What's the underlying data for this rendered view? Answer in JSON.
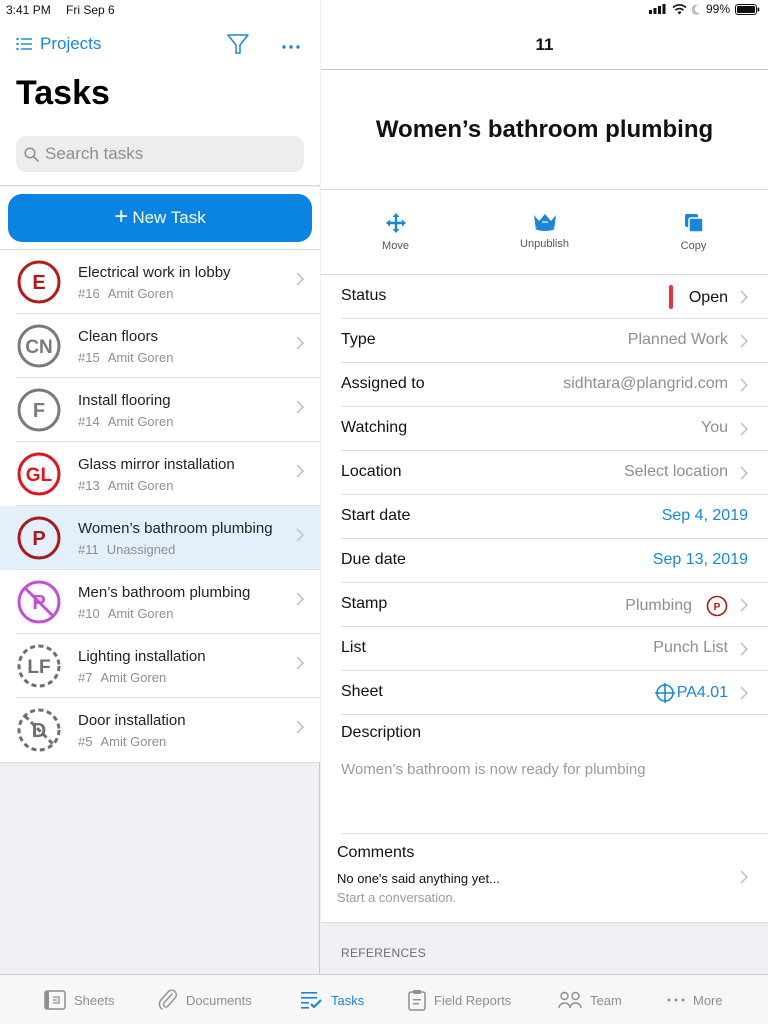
{
  "status_bar": {
    "time": "3:41 PM",
    "date": "Fri Sep 6",
    "battery": "99%"
  },
  "left": {
    "nav": {
      "projects_label": "Projects",
      "filter_icon": "filter-icon",
      "more_icon": "more-icon"
    },
    "title": "Tasks",
    "search": {
      "placeholder": "Search tasks",
      "value": ""
    },
    "new_task_label": "New Task",
    "tasks": [
      {
        "stamp": "E",
        "title": "Electrical work in lobby",
        "number": "#16",
        "assignee": "Amit Goren",
        "color": "#b31b1b",
        "style": "solid",
        "selected": false
      },
      {
        "stamp": "CN",
        "title": "Clean floors",
        "number": "#15",
        "assignee": "Amit Goren",
        "color": "#7a7a7a",
        "style": "solid",
        "selected": false
      },
      {
        "stamp": "F",
        "title": "Install flooring",
        "number": "#14",
        "assignee": "Amit Goren",
        "color": "#7a7a7a",
        "style": "solid",
        "selected": false
      },
      {
        "stamp": "GL",
        "title": "Glass mirror installation",
        "number": "#13",
        "assignee": "Amit Goren",
        "color": "#e0141c",
        "style": "solid",
        "selected": false
      },
      {
        "stamp": "P",
        "title": "Women’s bathroom plumbing",
        "number": "#11",
        "assignee": "Unassigned",
        "color": "#a51c1c",
        "style": "solid",
        "selected": true
      },
      {
        "stamp": "P",
        "title": "Men’s bathroom plumbing",
        "number": "#10",
        "assignee": "Amit Goren",
        "color": "#c24fd6",
        "style": "crossed",
        "selected": false
      },
      {
        "stamp": "LF",
        "title": "Lighting installation",
        "number": "#7",
        "assignee": "Amit Goren",
        "color": "#6e6e6e",
        "style": "dashed",
        "selected": false
      },
      {
        "stamp": "D",
        "title": "Door installation",
        "number": "#5",
        "assignee": "Amit Goren",
        "color": "#6e6e6e",
        "style": "dashed-crossed",
        "selected": false
      }
    ]
  },
  "detail": {
    "number": "11",
    "title": "Women’s bathroom plumbing",
    "actions": [
      {
        "label": "Move",
        "icon": "move-icon"
      },
      {
        "label": "Unpublish",
        "icon": "crown-icon"
      },
      {
        "label": "Copy",
        "icon": "copy-icon"
      }
    ],
    "fields": [
      {
        "label": "Status",
        "value": "Open",
        "status_color": "#e0373d"
      },
      {
        "label": "Type",
        "value": "Planned Work"
      },
      {
        "label": "Assigned to",
        "value": "sidhtara@plangrid.com"
      },
      {
        "label": "Watching",
        "value": "You"
      },
      {
        "label": "Location",
        "value": "Select location"
      },
      {
        "label": "Start date",
        "value": "Sep 4, 2019"
      },
      {
        "label": "Due date",
        "value": "Sep 13, 2019"
      },
      {
        "label": "Stamp",
        "value": "Plumbing",
        "stamp": "P"
      },
      {
        "label": "List",
        "value": "Punch List"
      },
      {
        "label": "Sheet",
        "value": "PA4.01"
      }
    ],
    "description": {
      "label": "Description",
      "text": "Women’s bathroom is now ready for plumbing"
    },
    "comments": {
      "label": "Comments",
      "empty_text": "No one's said anything yet...",
      "prompt": "Start a conversation."
    },
    "references_label": "REFERENCES"
  },
  "tabbar": {
    "tabs": [
      {
        "label": "Sheets",
        "active": false
      },
      {
        "label": "Documents",
        "active": false
      },
      {
        "label": "Tasks",
        "active": true
      },
      {
        "label": "Field Reports",
        "active": false
      },
      {
        "label": "Team",
        "active": false
      },
      {
        "label": "More",
        "active": false
      }
    ]
  },
  "colors": {
    "accent": "#1a86d9",
    "button": "#0a84e0",
    "selected_row": "#e3f0fb"
  }
}
